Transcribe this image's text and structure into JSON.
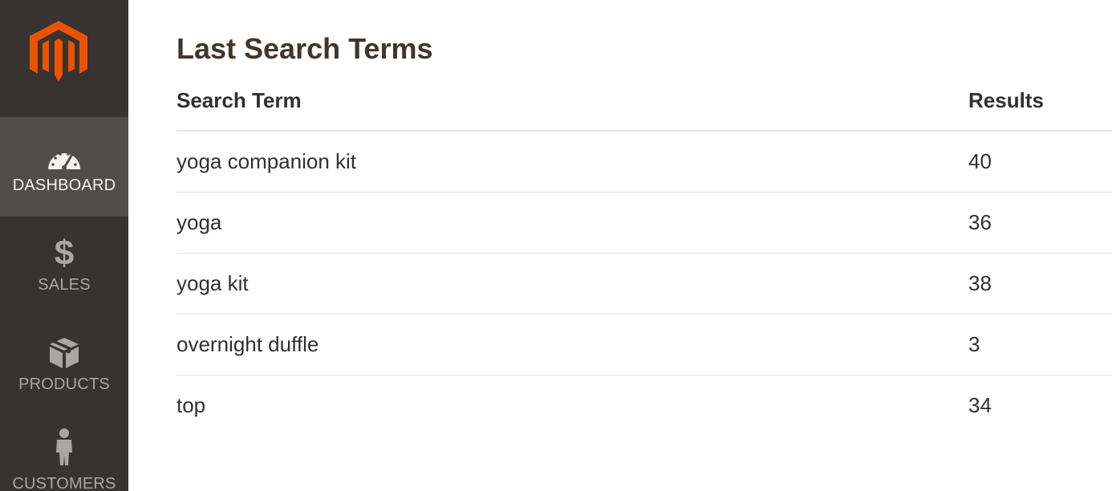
{
  "sidebar": {
    "logo_icon": "magento-logo-icon",
    "items": [
      {
        "label": "DASHBOARD",
        "icon": "dashboard-gauge-icon",
        "active": true
      },
      {
        "label": "SALES",
        "icon": "dollar-icon",
        "active": false
      },
      {
        "label": "PRODUCTS",
        "icon": "box-icon",
        "active": false
      },
      {
        "label": "CUSTOMERS",
        "icon": "person-icon",
        "active": false
      }
    ]
  },
  "main": {
    "title": "Last Search Terms",
    "table": {
      "headers": {
        "term": "Search Term",
        "results": "Results"
      },
      "rows": [
        {
          "term": "yoga companion kit",
          "results": "40"
        },
        {
          "term": "yoga",
          "results": "36"
        },
        {
          "term": "yoga kit",
          "results": "38"
        },
        {
          "term": "overnight duffle",
          "results": "3"
        },
        {
          "term": "top",
          "results": "34"
        }
      ]
    }
  },
  "colors": {
    "sidebar_bg": "#373330",
    "sidebar_active_bg": "#524d49",
    "logo_orange": "#eb5202",
    "title_color": "#41362f"
  }
}
